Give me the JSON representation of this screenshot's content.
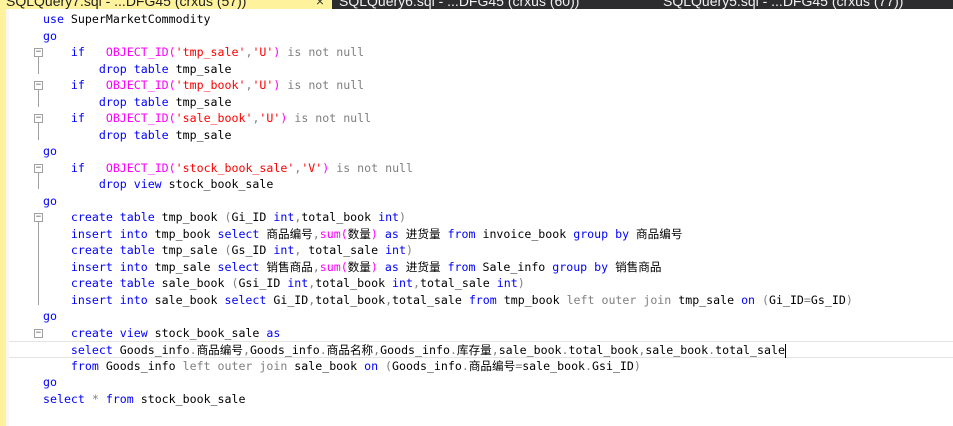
{
  "tabs": [
    {
      "label": "SQLQuery7.sql - ...DFG45 (crxus (57))",
      "close": "×"
    },
    {
      "label": "SQLQuery6.sql - ...DFG45 (crxus (60))"
    },
    {
      "label": "SQLQuery5.sql - ...DFG45 (crxus (77))"
    }
  ],
  "colors": {
    "keyword": "#0000ff",
    "function": "#ff00ff",
    "string": "#ff0000",
    "operator": "#808080",
    "changed": "#fff29d"
  },
  "fold_glyph": "−",
  "lines": [
    [
      {
        "t": "use",
        "c": "k"
      },
      {
        "t": " SuperMarketCommodity"
      }
    ],
    [
      {
        "t": "go",
        "c": "k"
      }
    ],
    [
      {
        "t": "    "
      },
      {
        "t": "if",
        "c": "k"
      },
      {
        "t": "   "
      },
      {
        "t": "OBJECT_ID(",
        "c": "f"
      },
      {
        "t": "'tmp_sale'",
        "c": "s"
      },
      {
        "t": ",",
        "c": "g"
      },
      {
        "t": "'U'",
        "c": "s"
      },
      {
        "t": ")",
        "c": "f"
      },
      {
        "t": " "
      },
      {
        "t": "is not null",
        "c": "g"
      }
    ],
    [
      {
        "t": "        "
      },
      {
        "t": "drop table",
        "c": "k"
      },
      {
        "t": " tmp_sale"
      }
    ],
    [
      {
        "t": "    "
      },
      {
        "t": "if",
        "c": "k"
      },
      {
        "t": "   "
      },
      {
        "t": "OBJECT_ID(",
        "c": "f"
      },
      {
        "t": "'tmp_book'",
        "c": "s"
      },
      {
        "t": ",",
        "c": "g"
      },
      {
        "t": "'U'",
        "c": "s"
      },
      {
        "t": ")",
        "c": "f"
      },
      {
        "t": " "
      },
      {
        "t": "is not null",
        "c": "g"
      }
    ],
    [
      {
        "t": "        "
      },
      {
        "t": "drop table",
        "c": "k"
      },
      {
        "t": " tmp_sale"
      }
    ],
    [
      {
        "t": "    "
      },
      {
        "t": "if",
        "c": "k"
      },
      {
        "t": "   "
      },
      {
        "t": "OBJECT_ID(",
        "c": "f"
      },
      {
        "t": "'sale_book'",
        "c": "s"
      },
      {
        "t": ",",
        "c": "g"
      },
      {
        "t": "'U'",
        "c": "s"
      },
      {
        "t": ")",
        "c": "f"
      },
      {
        "t": " "
      },
      {
        "t": "is not null",
        "c": "g"
      }
    ],
    [
      {
        "t": "        "
      },
      {
        "t": "drop table",
        "c": "k"
      },
      {
        "t": " tmp_sale"
      }
    ],
    [
      {
        "t": "go",
        "c": "k"
      }
    ],
    [
      {
        "t": "    "
      },
      {
        "t": "if",
        "c": "k"
      },
      {
        "t": "   "
      },
      {
        "t": "OBJECT_ID(",
        "c": "f"
      },
      {
        "t": "'stock_book_sale'",
        "c": "s"
      },
      {
        "t": ",",
        "c": "g"
      },
      {
        "t": "'V'",
        "c": "s"
      },
      {
        "t": ")",
        "c": "f"
      },
      {
        "t": " "
      },
      {
        "t": "is not null",
        "c": "g"
      }
    ],
    [
      {
        "t": "        "
      },
      {
        "t": "drop view",
        "c": "k"
      },
      {
        "t": " stock_book_sale"
      }
    ],
    [
      {
        "t": "go",
        "c": "k"
      }
    ],
    [
      {
        "t": "    "
      },
      {
        "t": "create table",
        "c": "k"
      },
      {
        "t": " tmp_book "
      },
      {
        "t": "(",
        "c": "g"
      },
      {
        "t": "Gi_ID "
      },
      {
        "t": "int",
        "c": "k"
      },
      {
        "t": ",",
        "c": "g"
      },
      {
        "t": "total_book "
      },
      {
        "t": "int",
        "c": "k"
      },
      {
        "t": ")",
        "c": "g"
      }
    ],
    [
      {
        "t": "    "
      },
      {
        "t": "insert into",
        "c": "k"
      },
      {
        "t": " tmp_book "
      },
      {
        "t": "select",
        "c": "k"
      },
      {
        "t": " 商品编号"
      },
      {
        "t": ",",
        "c": "g"
      },
      {
        "t": "sum(",
        "c": "f"
      },
      {
        "t": "数量"
      },
      {
        "t": ")",
        "c": "f"
      },
      {
        "t": " "
      },
      {
        "t": "as",
        "c": "k"
      },
      {
        "t": " 进货量 "
      },
      {
        "t": "from",
        "c": "k"
      },
      {
        "t": " invoice_book "
      },
      {
        "t": "group by",
        "c": "k"
      },
      {
        "t": " 商品编号"
      }
    ],
    [
      {
        "t": "    "
      },
      {
        "t": "create table",
        "c": "k"
      },
      {
        "t": " tmp_sale "
      },
      {
        "t": "(",
        "c": "g"
      },
      {
        "t": "Gs_ID "
      },
      {
        "t": "int",
        "c": "k"
      },
      {
        "t": ",",
        "c": "g"
      },
      {
        "t": " total_sale "
      },
      {
        "t": "int",
        "c": "k"
      },
      {
        "t": ")",
        "c": "g"
      }
    ],
    [
      {
        "t": "    "
      },
      {
        "t": "insert into",
        "c": "k"
      },
      {
        "t": " tmp_sale "
      },
      {
        "t": "select",
        "c": "k"
      },
      {
        "t": " 销售商品"
      },
      {
        "t": ",",
        "c": "g"
      },
      {
        "t": "sum(",
        "c": "f"
      },
      {
        "t": "数量"
      },
      {
        "t": ")",
        "c": "f"
      },
      {
        "t": " "
      },
      {
        "t": "as",
        "c": "k"
      },
      {
        "t": " 进货量 "
      },
      {
        "t": "from",
        "c": "k"
      },
      {
        "t": " Sale_info "
      },
      {
        "t": "group by",
        "c": "k"
      },
      {
        "t": " 销售商品"
      }
    ],
    [
      {
        "t": "    "
      },
      {
        "t": "create table",
        "c": "k"
      },
      {
        "t": " sale_book "
      },
      {
        "t": "(",
        "c": "g"
      },
      {
        "t": "Gsi_ID "
      },
      {
        "t": "int",
        "c": "k"
      },
      {
        "t": ",",
        "c": "g"
      },
      {
        "t": "total_book "
      },
      {
        "t": "int",
        "c": "k"
      },
      {
        "t": ",",
        "c": "g"
      },
      {
        "t": "total_sale "
      },
      {
        "t": "int",
        "c": "k"
      },
      {
        "t": ")",
        "c": "g"
      }
    ],
    [
      {
        "t": "    "
      },
      {
        "t": "insert into",
        "c": "k"
      },
      {
        "t": " sale_book "
      },
      {
        "t": "select",
        "c": "k"
      },
      {
        "t": " Gi_ID"
      },
      {
        "t": ",",
        "c": "g"
      },
      {
        "t": "total_book"
      },
      {
        "t": ",",
        "c": "g"
      },
      {
        "t": "total_sale "
      },
      {
        "t": "from",
        "c": "k"
      },
      {
        "t": " tmp_book "
      },
      {
        "t": "left outer join",
        "c": "g"
      },
      {
        "t": " tmp_sale "
      },
      {
        "t": "on",
        "c": "k"
      },
      {
        "t": " "
      },
      {
        "t": "(",
        "c": "g"
      },
      {
        "t": "Gi_ID"
      },
      {
        "t": "=",
        "c": "g"
      },
      {
        "t": "Gs_ID"
      },
      {
        "t": ")",
        "c": "g"
      }
    ],
    [
      {
        "t": "go",
        "c": "k"
      }
    ],
    [
      {
        "t": "    "
      },
      {
        "t": "create view",
        "c": "k"
      },
      {
        "t": " stock_book_sale "
      },
      {
        "t": "as",
        "c": "k"
      }
    ],
    [
      {
        "t": "    "
      },
      {
        "t": "select",
        "c": "k"
      },
      {
        "t": " Goods_info"
      },
      {
        "t": ".",
        "c": "g"
      },
      {
        "t": "商品编号"
      },
      {
        "t": ",",
        "c": "g"
      },
      {
        "t": "Goods_info"
      },
      {
        "t": ".",
        "c": "g"
      },
      {
        "t": "商品名称"
      },
      {
        "t": ",",
        "c": "g"
      },
      {
        "t": "Goods_info"
      },
      {
        "t": ".",
        "c": "g"
      },
      {
        "t": "库存量"
      },
      {
        "t": ",",
        "c": "g"
      },
      {
        "t": "sale_book"
      },
      {
        "t": ".",
        "c": "g"
      },
      {
        "t": "total_book"
      },
      {
        "t": ",",
        "c": "g"
      },
      {
        "t": "sale_book"
      },
      {
        "t": ".",
        "c": "g"
      },
      {
        "t": "total_sale"
      }
    ],
    [
      {
        "t": "    "
      },
      {
        "t": "from",
        "c": "k"
      },
      {
        "t": " Goods_info "
      },
      {
        "t": "left outer join",
        "c": "g"
      },
      {
        "t": " sale_book "
      },
      {
        "t": "on",
        "c": "k"
      },
      {
        "t": " "
      },
      {
        "t": "(",
        "c": "g"
      },
      {
        "t": "Goods_info"
      },
      {
        "t": ".",
        "c": "g"
      },
      {
        "t": "商品编号"
      },
      {
        "t": "=",
        "c": "g"
      },
      {
        "t": "sale_book"
      },
      {
        "t": ".",
        "c": "g"
      },
      {
        "t": "Gsi_ID"
      },
      {
        "t": ")",
        "c": "g"
      }
    ],
    [
      {
        "t": "go",
        "c": "k"
      }
    ],
    [
      {
        "t": "select",
        "c": "k"
      },
      {
        "t": " "
      },
      {
        "t": "*",
        "c": "g"
      },
      {
        "t": " "
      },
      {
        "t": "from",
        "c": "k"
      },
      {
        "t": " stock_book_sale"
      }
    ]
  ],
  "fold_lines": [
    2,
    4,
    6,
    9,
    12,
    19
  ],
  "cursor_line": 20
}
